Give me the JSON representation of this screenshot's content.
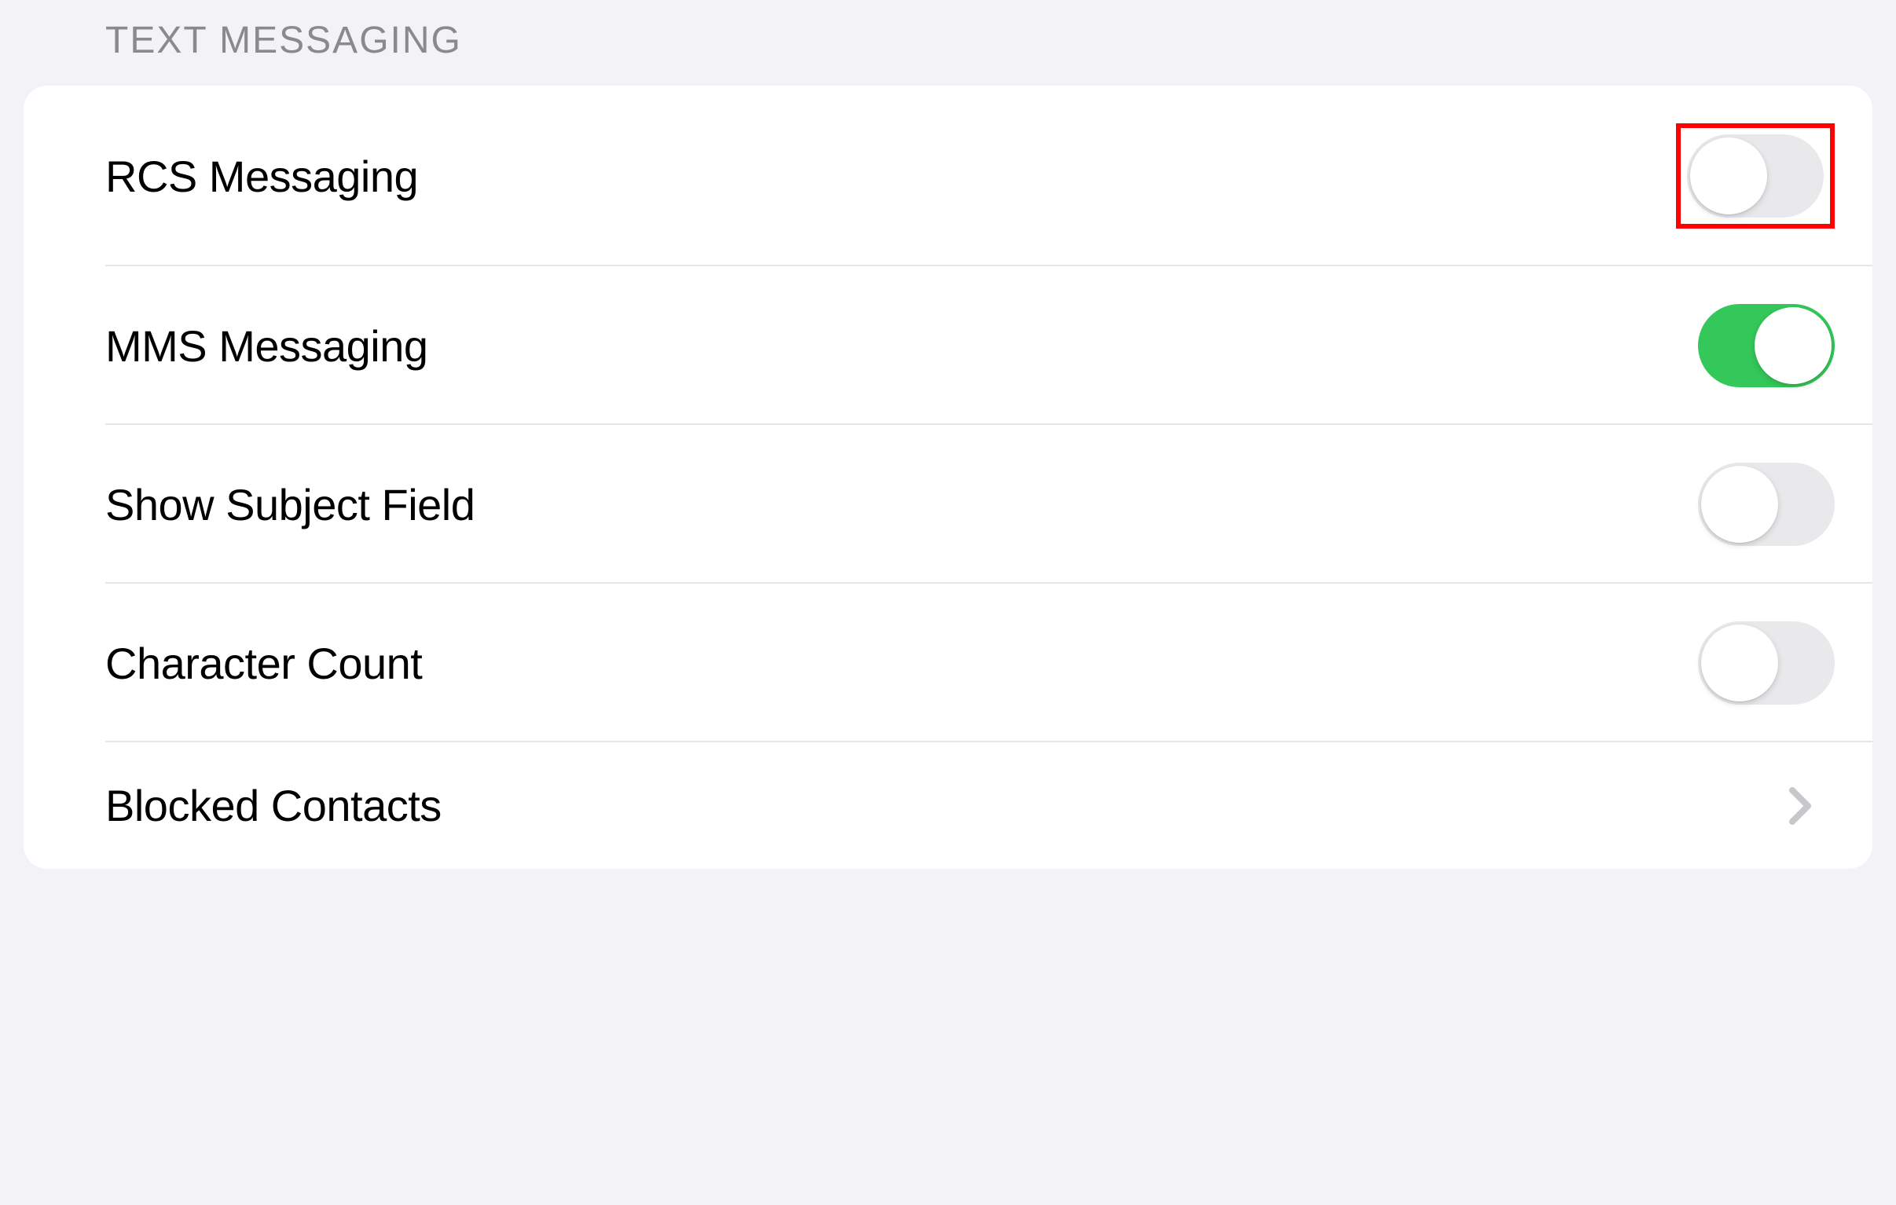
{
  "section": {
    "header": "TEXT MESSAGING",
    "rows": [
      {
        "label": "RCS Messaging",
        "type": "toggle",
        "state": "off",
        "highlighted": true
      },
      {
        "label": "MMS Messaging",
        "type": "toggle",
        "state": "on",
        "highlighted": false
      },
      {
        "label": "Show Subject Field",
        "type": "toggle",
        "state": "off",
        "highlighted": false
      },
      {
        "label": "Character Count",
        "type": "toggle",
        "state": "off",
        "highlighted": false
      },
      {
        "label": "Blocked Contacts",
        "type": "nav",
        "state": null,
        "highlighted": false
      }
    ]
  },
  "colors": {
    "toggle_on": "#34c759",
    "toggle_off": "#e9e9eb",
    "highlight": "#ff0000",
    "background": "#f2f2f7",
    "chevron": "#c7c7cc"
  }
}
